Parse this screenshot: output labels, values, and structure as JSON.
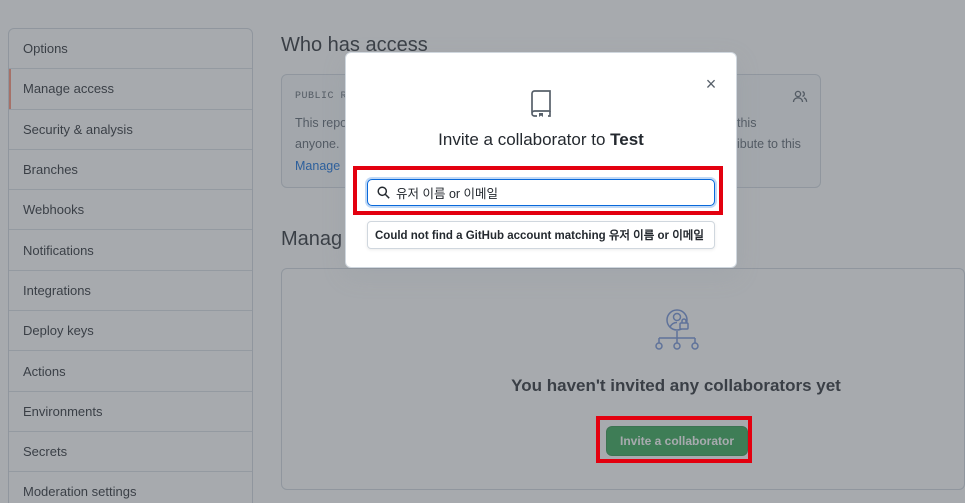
{
  "sidebar": {
    "items": [
      {
        "label": "Options"
      },
      {
        "label": "Manage access"
      },
      {
        "label": "Security & analysis"
      },
      {
        "label": "Branches"
      },
      {
        "label": "Webhooks"
      },
      {
        "label": "Notifications"
      },
      {
        "label": "Integrations"
      },
      {
        "label": "Deploy keys"
      },
      {
        "label": "Actions"
      },
      {
        "label": "Environments"
      },
      {
        "label": "Secrets"
      },
      {
        "label": "Moderation settings"
      }
    ]
  },
  "who_has_access": {
    "title": "Who has access",
    "label": "PUBLIC RE",
    "desc_left": "This repo",
    "desc_left2": "anyone.",
    "desc_right": "this",
    "desc_right2": "ibute to this",
    "link": "Manage"
  },
  "manage": {
    "title": "Manag",
    "empty_text": "You haven't invited any collaborators yet",
    "invite_button": "Invite a collaborator"
  },
  "modal": {
    "close_label": "×",
    "title_prefix": "Invite a collaborator to ",
    "repo_name": "Test",
    "search_value": "유저 이름 or 이메일",
    "no_match_text": "Could not find a GitHub account matching 유저 이름 or 이메일"
  },
  "colors": {
    "highlight": "#e3000f",
    "primary_button": "#2da44e",
    "link": "#0969da"
  }
}
